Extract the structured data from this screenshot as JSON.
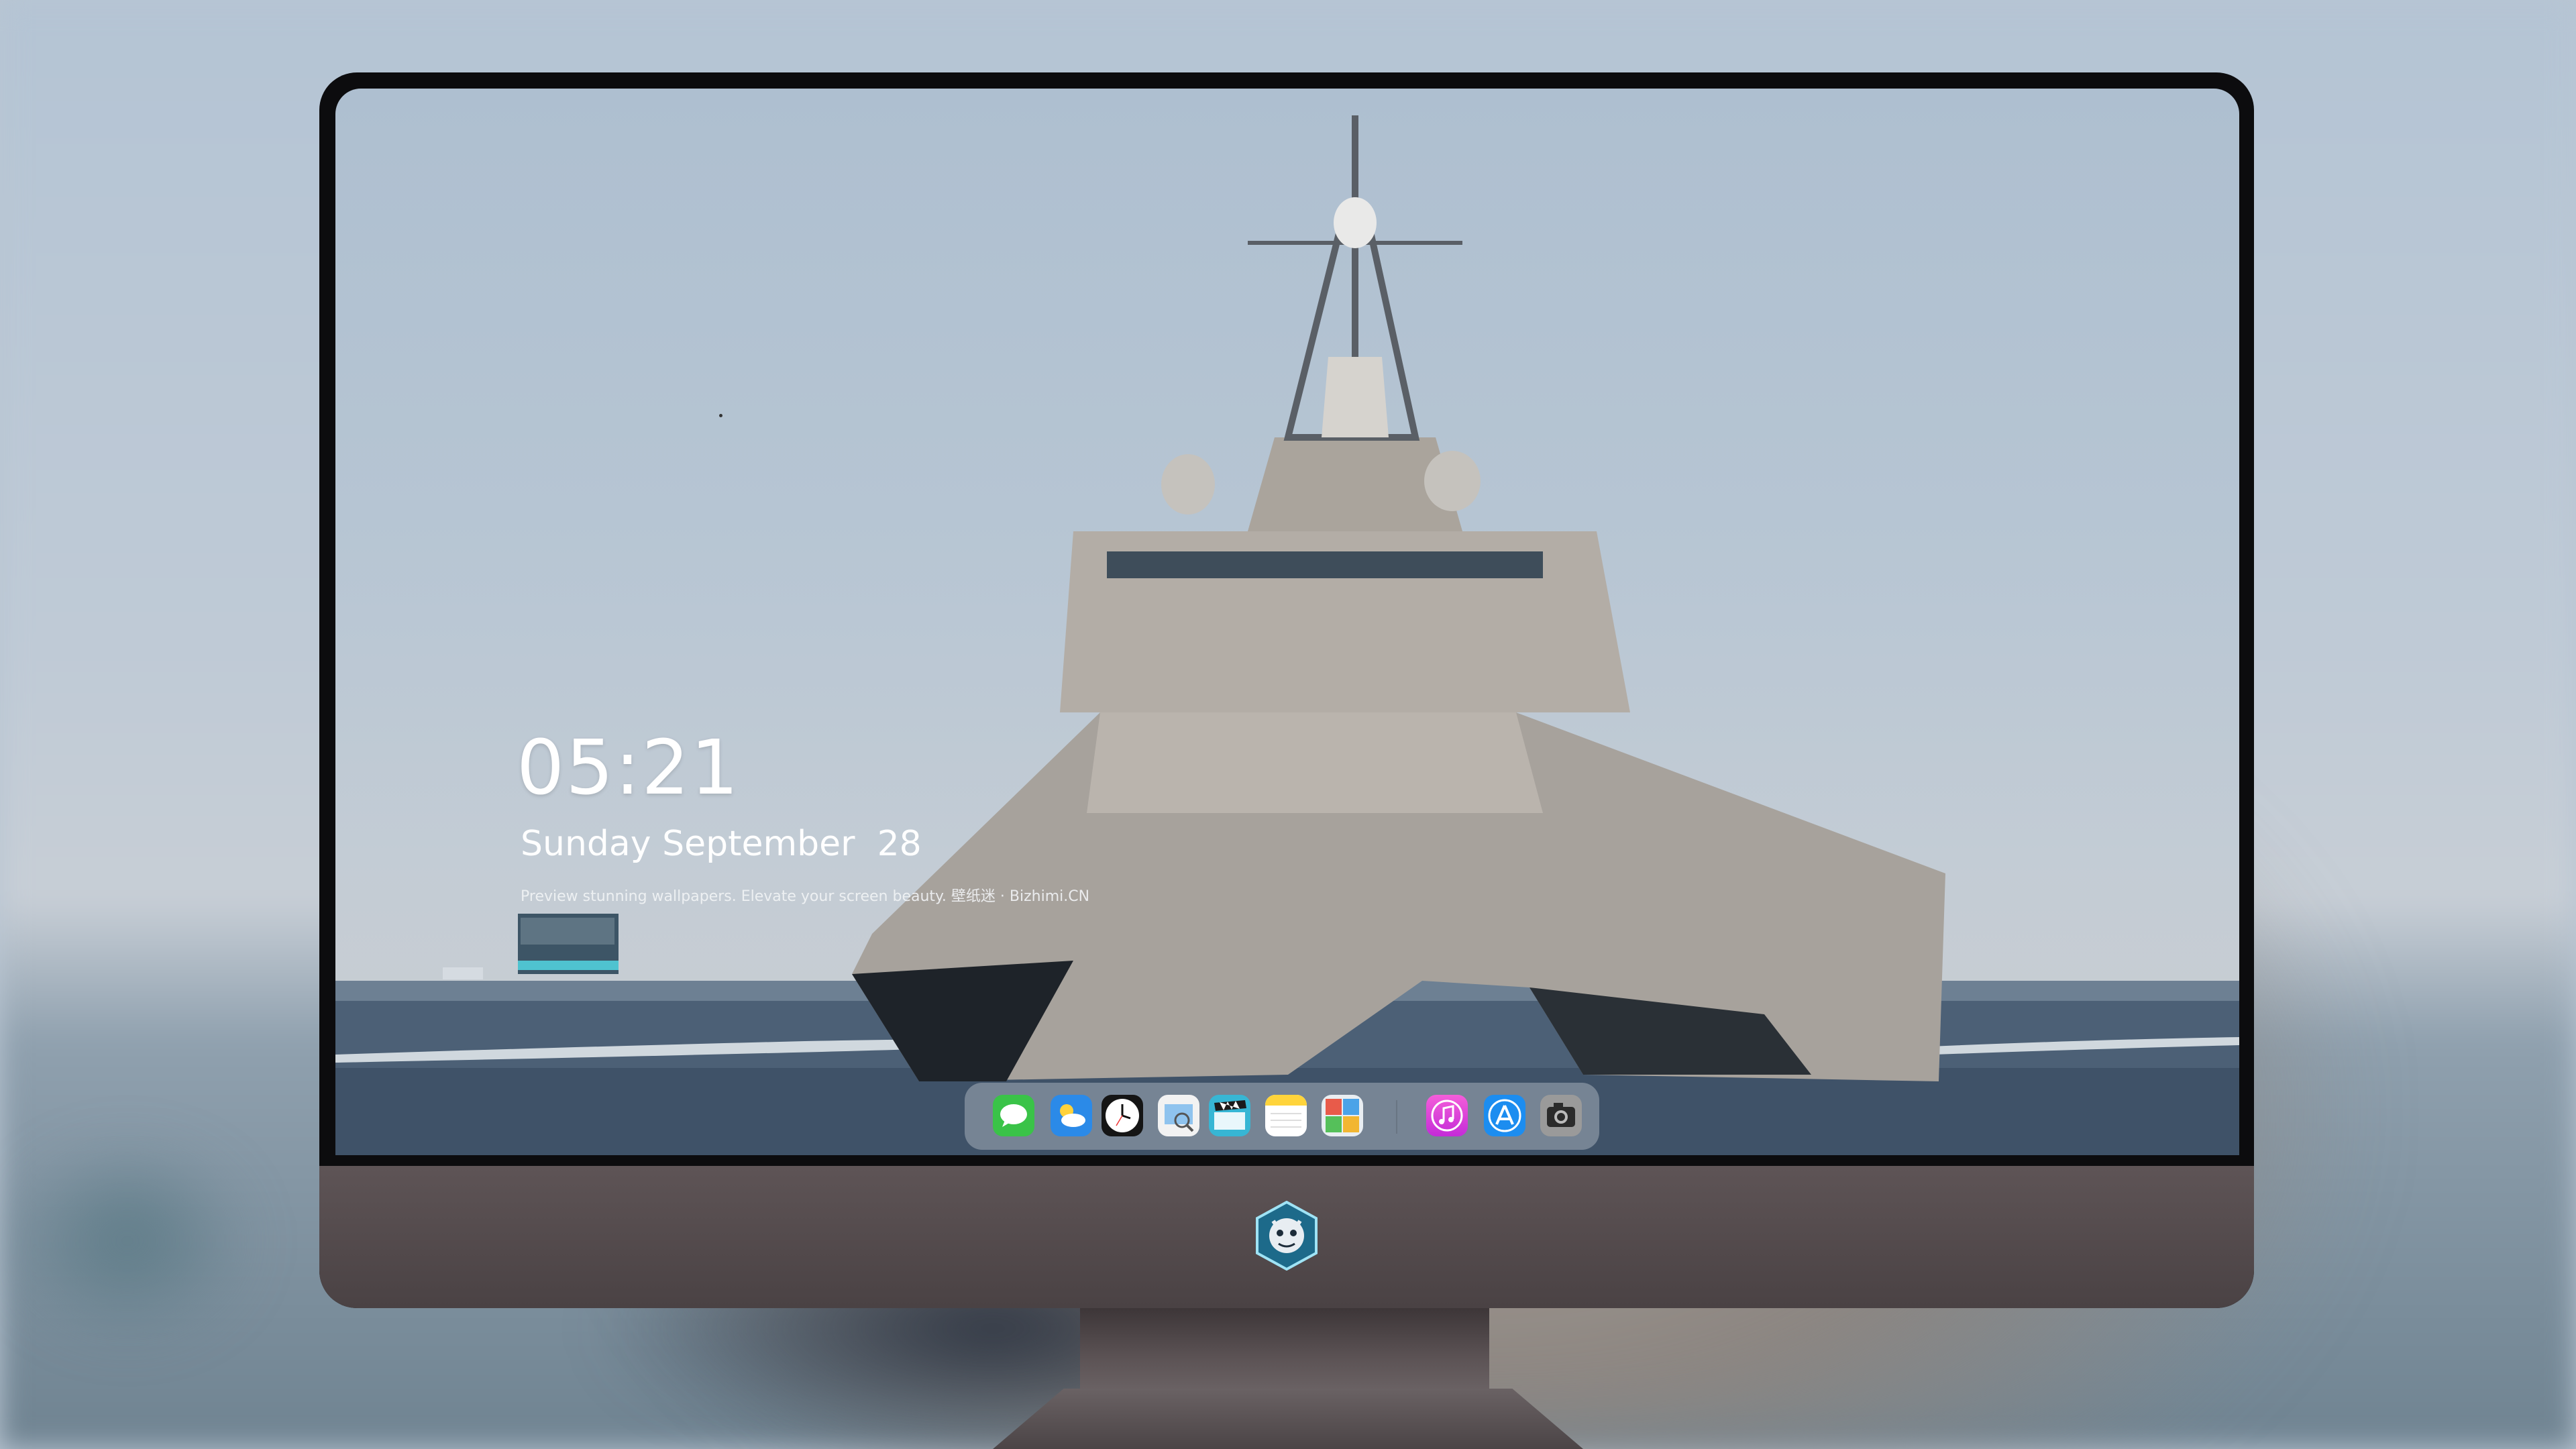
{
  "lockscreen": {
    "time": "05:21",
    "date": "Sunday September  28",
    "tagline": "Preview stunning wallpapers. Elevate your screen beauty. 壁纸迷 · Bizhimi.CN"
  },
  "dock": {
    "apps": [
      {
        "name": "messages-icon"
      },
      {
        "name": "weather-icon"
      },
      {
        "name": "clock-icon"
      },
      {
        "name": "preview-icon"
      },
      {
        "name": "claquette-icon"
      },
      {
        "name": "notes-icon"
      },
      {
        "name": "photo-booth-icon"
      },
      {
        "name": "music-icon"
      },
      {
        "name": "app-store-icon"
      },
      {
        "name": "camera-icon"
      }
    ]
  },
  "colors": {
    "monitor_bezel": "#0c0c0e",
    "monitor_chin": "#544b4d",
    "sky": "#b6c5d3",
    "sea": "#4b5e73"
  }
}
